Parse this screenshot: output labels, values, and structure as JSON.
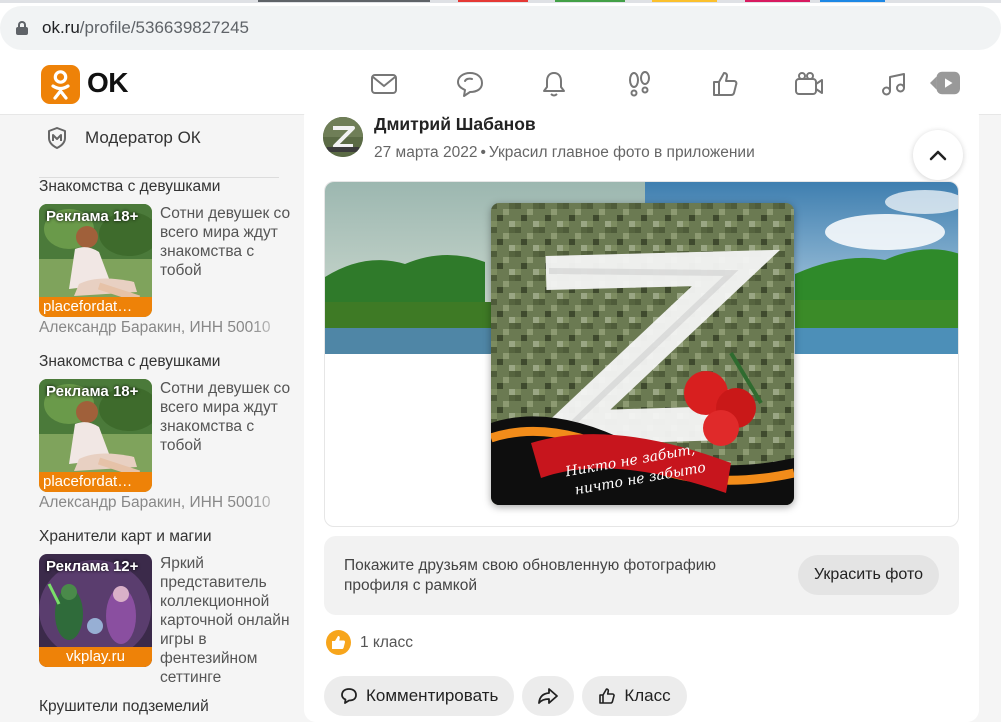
{
  "browser": {
    "url_host": "ok.ru",
    "url_path": "/profile/536639827245"
  },
  "header": {
    "logo_text": "OK",
    "nav": [
      {
        "name": "messages-icon"
      },
      {
        "name": "discussions-icon"
      },
      {
        "name": "notifications-icon"
      },
      {
        "name": "guests-icon"
      },
      {
        "name": "events-icon"
      },
      {
        "name": "video-calls-icon"
      },
      {
        "name": "music-icon"
      },
      {
        "name": "video-icon"
      }
    ],
    "brand_color": "#ee8208"
  },
  "sidebar": {
    "moderator_label": "Модератор ОК",
    "ads": [
      {
        "title": "Знакомства с девушками",
        "age": "Реклама 18+",
        "source": "placefordat…",
        "text": "Сотни девушек со всего мира ждут знакомства с тобой",
        "owner": "Александр Баракин, ИНН 50010"
      },
      {
        "title": "Знакомства с девушками",
        "age": "Реклама 18+",
        "source": "placefordat…",
        "text": "Сотни девушек со всего мира ждут знакомства с тобой",
        "owner": "Александр Баракин, ИНН 50010"
      },
      {
        "title": "Хранители карт и магии",
        "age": "Реклама 12+",
        "source": "vkplay.ru",
        "text": "Яркий представитель коллекционной карточной онлайн игры в фентезийном сеттинге"
      }
    ],
    "next_ad_title": "Крушители подземелий"
  },
  "post": {
    "author": "Дмитрий Шабанов",
    "date": "27 марта 2022",
    "action": "Украсил главное фото в приложении",
    "image_caption_line1": "Никто не забыт,",
    "image_caption_line2": "ничто не забыто",
    "promo_text": "Покажите друзьям свою обновленную фотографию профиля с рамкой",
    "promo_button": "Украсить фото",
    "likes_count": "1 класс",
    "comment_label": "Комментировать",
    "like_label": "Класс"
  }
}
